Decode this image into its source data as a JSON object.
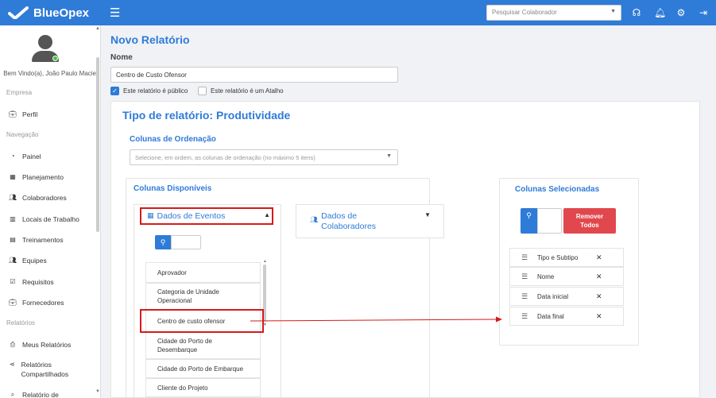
{
  "app": {
    "brand": "BlueOpex"
  },
  "topbar": {
    "search_placeholder": "Pesquisar Colaborador",
    "icons": [
      "headset-icon",
      "bell-icon",
      "gear-icon",
      "logout-icon"
    ]
  },
  "sidebar": {
    "welcome": "Bem Vindo(a), João Paulo Maciel",
    "sections": {
      "empresa": "Empresa",
      "navegacao": "Navegação",
      "relatorios": "Relatórios"
    },
    "items": {
      "perfil": "Perfil",
      "painel": "Painel",
      "planejamento": "Planejamento",
      "colaboradores": "Colaboradores",
      "locais": "Locais de Trabalho",
      "treinamentos": "Treinamentos",
      "equipes": "Equipes",
      "requisitos": "Requisitos",
      "fornecedores": "Fornecedores",
      "meus_relatorios": "Meus Relatórios",
      "compartilhados": "Relatórios Compartilhados",
      "relatorio_de": "Relatório de"
    }
  },
  "main": {
    "title": "Novo Relatório",
    "nome_label": "Nome",
    "nome_value": "Centro de Custo Ofensor",
    "check_publico": {
      "label": "Este relatório é público",
      "checked": true
    },
    "check_atalho": {
      "label": "Este relatório é um Atalho",
      "checked": false
    },
    "report_type": "Tipo de relatório: Produtividade",
    "ordenacao": {
      "label": "Colunas de Ordenação",
      "placeholder": "Selecione, em ordem, as colunas de ordenação (no máximo 5 itens)"
    },
    "disponiveis": {
      "title": "Colunas Disponíveis",
      "group_eventos": "Dados de Eventos",
      "group_colaboradores": "Dados de Colaboradores",
      "items": [
        "Aprovador",
        "Categoria de Unidade Operacional",
        "Centro de custo ofensor",
        "Cidade do Porto de Desembarque",
        "Cidade do Porto de Embarque",
        "Cliente do Projeto"
      ]
    },
    "selecionadas": {
      "title": "Colunas Selecionadas",
      "remove_label": "Remover Todos",
      "items": [
        "Tipo e Subtipo",
        "Nome",
        "Data inicial",
        "Data final"
      ]
    }
  },
  "colors": {
    "primary": "#2f7bd8",
    "danger": "#e0484e",
    "annotation": "#d61a1a"
  }
}
